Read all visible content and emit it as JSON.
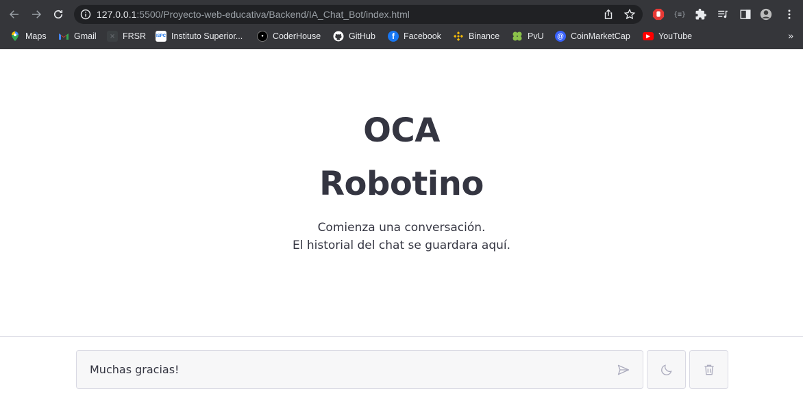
{
  "browser": {
    "url_host": "127.0.0.1",
    "url_rest": ":5500/Proyecto-web-educativa/Backend/IA_Chat_Bot/index.html",
    "bookmarks": [
      {
        "label": "Maps",
        "icon": "maps-icon",
        "color": "#34a853"
      },
      {
        "label": "Gmail",
        "icon": "gmail-icon",
        "color": "#ea4335"
      },
      {
        "label": "FRSR",
        "icon": "frsr-icon",
        "color": "#5f6368"
      },
      {
        "label": "Instituto Superior...",
        "icon": "ispc-icon",
        "color": "#1a73e8",
        "glyph": "ISPC"
      },
      {
        "label": "CoderHouse",
        "icon": "coderhouse-icon",
        "color": "#000000",
        "glyph": "C"
      },
      {
        "label": "GitHub",
        "icon": "github-icon",
        "color": "#ffffff"
      },
      {
        "label": "Facebook",
        "icon": "facebook-icon",
        "color": "#1877f2"
      },
      {
        "label": "Binance",
        "icon": "binance-icon",
        "color": "#f0b90b"
      },
      {
        "label": "PvU",
        "icon": "pvu-icon",
        "color": "#8bc34a"
      },
      {
        "label": "CoinMarketCap",
        "icon": "coinmarketcap-icon",
        "color": "#3861fb"
      },
      {
        "label": "YouTube",
        "icon": "youtube-icon",
        "color": "#ff0000"
      }
    ],
    "more_bookmarks": "»"
  },
  "hero": {
    "title_line1": "OCA",
    "title_line2": "Robotino",
    "subtitle_line1": "Comienza una conversación.",
    "subtitle_line2": "El historial del chat se guardara aquí."
  },
  "chat": {
    "input_value": "Muchas gracias!"
  },
  "colors": {
    "text": "#343541",
    "icon": "#acacbe",
    "input_bg": "#f7f7f8",
    "chrome_bg": "#35363a"
  }
}
